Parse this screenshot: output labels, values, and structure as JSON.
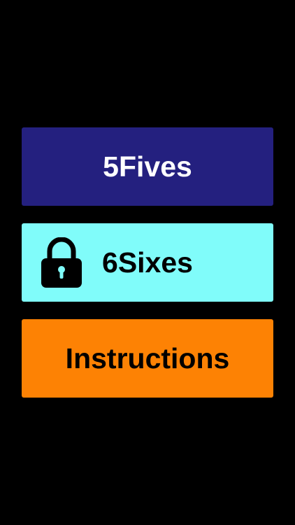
{
  "menu": {
    "fives": {
      "label": "5Fives",
      "color": "#24207f",
      "text_color": "#ffffff"
    },
    "sixes": {
      "label": "6Sixes",
      "color": "#80fcfa",
      "text_color": "#000000",
      "icon": "padlock-icon",
      "locked": true
    },
    "instructions": {
      "label": "Instructions",
      "color": "#fd8204",
      "text_color": "#000000"
    }
  },
  "background_color": "#000000"
}
